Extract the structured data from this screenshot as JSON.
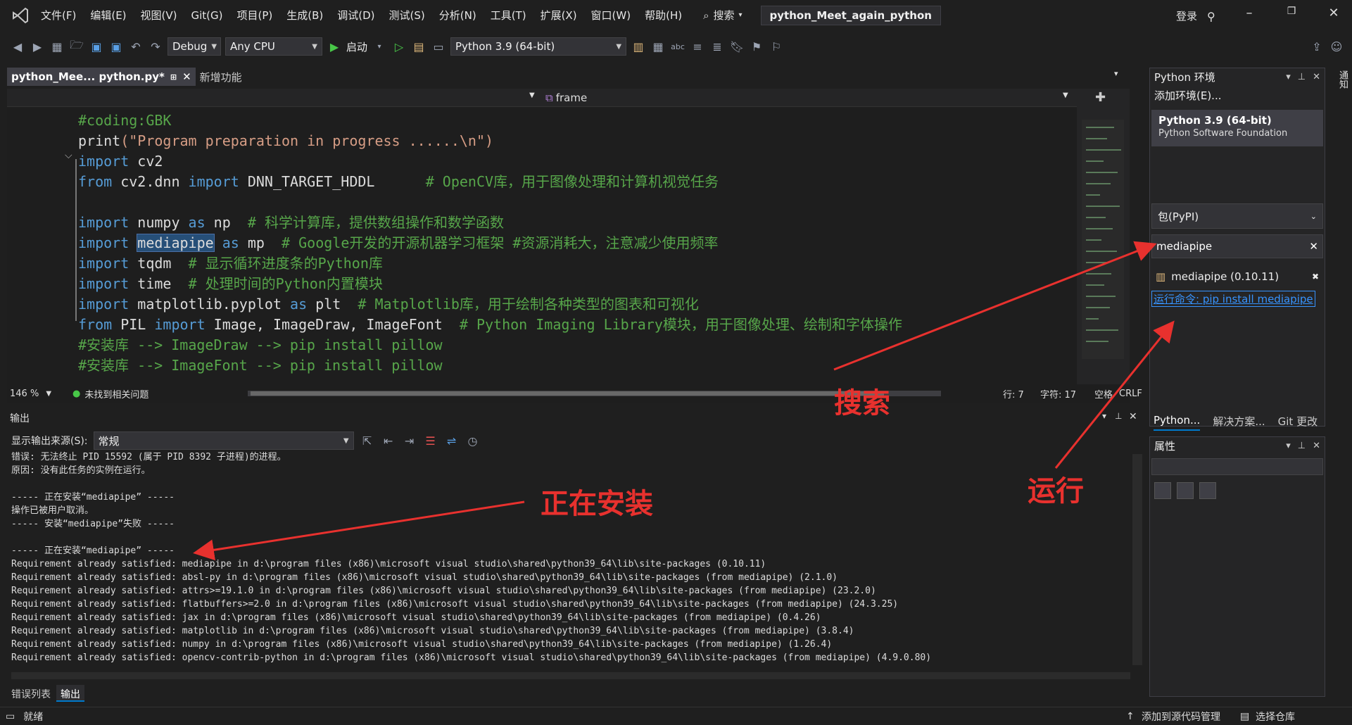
{
  "menubar": {
    "items": [
      "文件(F)",
      "编辑(E)",
      "视图(V)",
      "Git(G)",
      "项目(P)",
      "生成(B)",
      "调试(D)",
      "测试(S)",
      "分析(N)",
      "工具(T)",
      "扩展(X)",
      "窗口(W)",
      "帮助(H)"
    ],
    "search": "搜索",
    "solution_title": "python_Meet_again_python",
    "login": "登录"
  },
  "toolbar": {
    "config": "Debug",
    "platform": "Any CPU",
    "start": "启动",
    "interpreter": "Python 3.9 (64-bit)"
  },
  "tabs": {
    "active": "python_Mee... python.py*",
    "other": "新增功能"
  },
  "navbar": {
    "frame": "frame"
  },
  "code": [
    [
      {
        "t": "#coding:GBK",
        "c": "cm"
      }
    ],
    [
      {
        "t": "print",
        "c": "id"
      },
      {
        "t": "(\"Program preparation in progress ......\\n\")",
        "c": "st"
      }
    ],
    [
      {
        "t": "import",
        "c": "kw"
      },
      {
        "t": " cv2",
        "c": "id"
      }
    ],
    [
      {
        "t": "from",
        "c": "kw"
      },
      {
        "t": " cv2.dnn ",
        "c": "id"
      },
      {
        "t": "import",
        "c": "kw"
      },
      {
        "t": " DNN_TARGET_HDDL      ",
        "c": "id"
      },
      {
        "t": "# OpenCV库，用于图像处理和计算机视觉任务",
        "c": "cm"
      }
    ],
    [
      {
        "t": "",
        "c": "id"
      }
    ],
    [
      {
        "t": "import",
        "c": "kw"
      },
      {
        "t": " numpy ",
        "c": "id"
      },
      {
        "t": "as",
        "c": "kw"
      },
      {
        "t": " np  ",
        "c": "id"
      },
      {
        "t": "# 科学计算库，提供数组操作和数学函数",
        "c": "cm"
      }
    ],
    [
      {
        "t": "import",
        "c": "kw"
      },
      {
        "t": " ",
        "c": "id"
      },
      {
        "t": "mediapipe",
        "c": "id hl"
      },
      {
        "t": " ",
        "c": "id"
      },
      {
        "t": "as",
        "c": "kw"
      },
      {
        "t": " mp  ",
        "c": "id"
      },
      {
        "t": "# Google开发的开源机器学习框架 #资源消耗大，注意减少使用频率",
        "c": "cm"
      }
    ],
    [
      {
        "t": "import",
        "c": "kw"
      },
      {
        "t": " tqdm  ",
        "c": "id"
      },
      {
        "t": "# 显示循环进度条的Python库",
        "c": "cm"
      }
    ],
    [
      {
        "t": "import",
        "c": "kw"
      },
      {
        "t": " time  ",
        "c": "id"
      },
      {
        "t": "# 处理时间的Python内置模块",
        "c": "cm"
      }
    ],
    [
      {
        "t": "import",
        "c": "kw"
      },
      {
        "t": " matplotlib.pyplot ",
        "c": "id"
      },
      {
        "t": "as",
        "c": "kw"
      },
      {
        "t": " plt  ",
        "c": "id"
      },
      {
        "t": "# Matplotlib库，用于绘制各种类型的图表和可视化",
        "c": "cm"
      }
    ],
    [
      {
        "t": "from",
        "c": "kw"
      },
      {
        "t": " PIL ",
        "c": "id"
      },
      {
        "t": "import",
        "c": "kw"
      },
      {
        "t": " Image, ImageDraw, ImageFont  ",
        "c": "id"
      },
      {
        "t": "# Python Imaging Library模块，用于图像处理、绘制和字体操作",
        "c": "cm"
      }
    ],
    [
      {
        "t": "#安装库 --> ImageDraw --> pip install pillow",
        "c": "cm"
      }
    ],
    [
      {
        "t": "#安装库 --> ImageFont --> pip install pillow",
        "c": "cm"
      }
    ]
  ],
  "editor_status": {
    "zoom": "146 %",
    "issues": "未找到相关问题",
    "line": "行: 7",
    "char": "字符: 17",
    "spaces": "空格",
    "eol": "CRLF"
  },
  "output": {
    "title": "输出",
    "source_label": "显示输出来源(S):",
    "source_value": "常规",
    "lines": [
      "错误: 无法终止 PID 15592 (属于 PID 8392 子进程)的进程。",
      "原因: 没有此任务的实例在运行。",
      "",
      "----- 正在安装“mediapipe” -----",
      "操作已被用户取消。",
      "----- 安装“mediapipe”失败 -----",
      "",
      "----- 正在安装“mediapipe” -----",
      "Requirement already satisfied: mediapipe in d:\\program files (x86)\\microsoft visual studio\\shared\\python39_64\\lib\\site-packages (0.10.11)",
      "Requirement already satisfied: absl-py in d:\\program files (x86)\\microsoft visual studio\\shared\\python39_64\\lib\\site-packages (from mediapipe) (2.1.0)",
      "Requirement already satisfied: attrs>=19.1.0 in d:\\program files (x86)\\microsoft visual studio\\shared\\python39_64\\lib\\site-packages (from mediapipe) (23.2.0)",
      "Requirement already satisfied: flatbuffers>=2.0 in d:\\program files (x86)\\microsoft visual studio\\shared\\python39_64\\lib\\site-packages (from mediapipe) (24.3.25)",
      "Requirement already satisfied: jax in d:\\program files (x86)\\microsoft visual studio\\shared\\python39_64\\lib\\site-packages (from mediapipe) (0.4.26)",
      "Requirement already satisfied: matplotlib in d:\\program files (x86)\\microsoft visual studio\\shared\\python39_64\\lib\\site-packages (from mediapipe) (3.8.4)",
      "Requirement already satisfied: numpy in d:\\program files (x86)\\microsoft visual studio\\shared\\python39_64\\lib\\site-packages (from mediapipe) (1.26.4)",
      "Requirement already satisfied: opencv-contrib-python in d:\\program files (x86)\\microsoft visual studio\\shared\\python39_64\\lib\\site-packages (from mediapipe) (4.9.0.80)"
    ],
    "tabs": [
      "错误列表",
      "输出"
    ]
  },
  "statusbar": {
    "ready": "就绪",
    "add_source": "添加到源代码管理",
    "select_repo": "选择仓库"
  },
  "py_env": {
    "title": "Python 环境",
    "add_env": "添加环境(E)...",
    "env_name": "Python 3.9 (64-bit)",
    "env_vendor": "Python Software Foundation",
    "pkg_source": "包(PyPI)",
    "search_value": "mediapipe",
    "pkg_item": "mediapipe (0.10.11)",
    "run_cmd": "运行命令: pip install mediapipe"
  },
  "right_tabs": [
    "Python...",
    "解决方案...",
    "Git 更改"
  ],
  "props": {
    "title": "属性"
  },
  "side_strip": "通知",
  "annotations": {
    "search": "搜索",
    "run": "运行",
    "installing": "正在安装"
  },
  "colors": {
    "accent": "#007acc",
    "annotation": "#e8312e",
    "keyword": "#569cd6",
    "comment": "#57a64a",
    "string": "#d69d85"
  }
}
